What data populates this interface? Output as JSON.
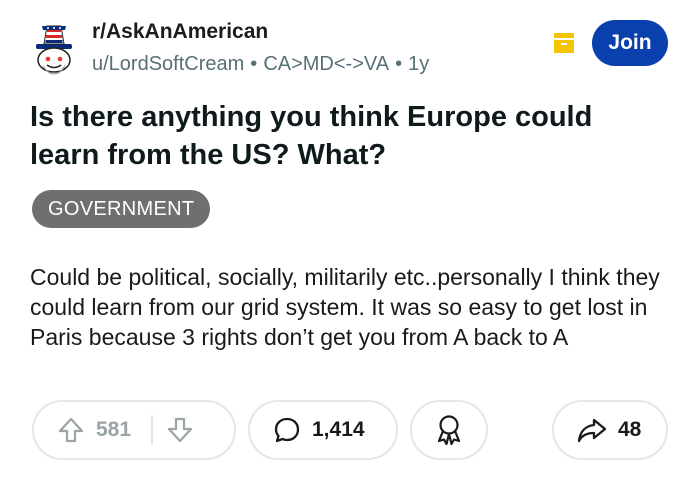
{
  "post": {
    "subreddit": "r/AskAnAmerican",
    "author": "u/LordSoftCream",
    "flair_user": "CA>MD<->VA",
    "age": "1y",
    "join_label": "Join",
    "title": "Is there anything you think Europe could learn from the US? What?",
    "flair": "GOVERNMENT",
    "body": "Could be political, socially, militarily etc..personally I think they could learn from our grid system. It was so easy to get lost in Paris because 3 rights don’t get you from A back to A"
  },
  "actions": {
    "upvotes": "581",
    "comments": "1,414",
    "shares": "48"
  },
  "icons": {
    "avatar": "uncle-sam-snoo-icon",
    "save": "save-icon",
    "upvote": "arrow-up-icon",
    "downvote": "arrow-down-icon",
    "comment": "speech-bubble-icon",
    "award": "award-ribbon-icon",
    "share": "share-arrow-icon"
  },
  "colors": {
    "join_button": "#0a3fae",
    "flair_bg": "#6f6f6f",
    "meta_text": "#576f76",
    "save_icon": "#f5c400"
  }
}
